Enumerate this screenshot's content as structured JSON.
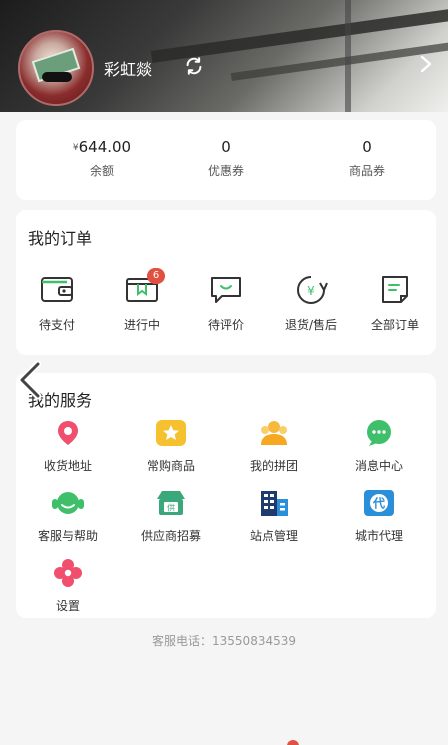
{
  "profile": {
    "username": "彩虹燚",
    "icons": {
      "avatar": "avatar-photo",
      "refresh": "refresh-icon",
      "chevron": "chevron-right-icon"
    }
  },
  "stats": [
    {
      "currency": "¥",
      "value": "644.00",
      "label": "余额"
    },
    {
      "currency": "",
      "value": "0",
      "label": "优惠券"
    },
    {
      "currency": "",
      "value": "0",
      "label": "商品券"
    }
  ],
  "orders": {
    "title": "我的订单",
    "items": [
      {
        "label": "待支付",
        "icon": "wallet-icon"
      },
      {
        "label": "进行中",
        "icon": "bookmark-box-icon",
        "badge": "6"
      },
      {
        "label": "待评价",
        "icon": "chat-smile-icon"
      },
      {
        "label": "退货/售后",
        "icon": "refund-yen-icon",
        "yen": "¥"
      },
      {
        "label": "全部订单",
        "icon": "document-list-icon"
      }
    ]
  },
  "services": {
    "title": "我的服务",
    "items": [
      {
        "label": "收货地址",
        "icon": "location-pin-icon"
      },
      {
        "label": "常购商品",
        "icon": "star-badge-icon"
      },
      {
        "label": "我的拼团",
        "icon": "group-people-icon"
      },
      {
        "label": "消息中心",
        "icon": "message-bubble-icon"
      },
      {
        "label": "客服与帮助",
        "icon": "headset-icon"
      },
      {
        "label": "供应商招募",
        "icon": "supplier-shop-icon",
        "glyph": "供"
      },
      {
        "label": "站点管理",
        "icon": "building-icon"
      },
      {
        "label": "城市代理",
        "icon": "agent-icon",
        "glyph": "代"
      },
      {
        "label": "设置",
        "icon": "settings-flower-icon"
      }
    ]
  },
  "hotline": {
    "label": "客服电话：",
    "number": "13550834539"
  },
  "colors": {
    "accent_red": "#e25040",
    "green": "#3fbf6a",
    "yellow": "#f6c12e",
    "blue": "#2a8fd8",
    "pink": "#f0506e",
    "dark_navy": "#1f3a6e"
  }
}
